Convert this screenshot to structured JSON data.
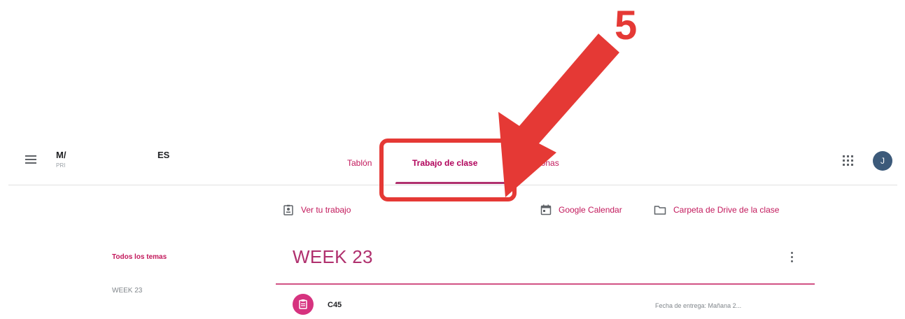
{
  "annotation": {
    "step_number": "5",
    "color": "#e53935"
  },
  "header": {
    "class_name": "M/",
    "class_name_extra": "ES",
    "class_section": "PRI",
    "avatar_initial": "J",
    "avatar_color": "#3c5a7a",
    "tabs": [
      {
        "label": "Tablón"
      },
      {
        "label": "Trabajo de clase",
        "active": true
      },
      {
        "label": "Personas"
      }
    ]
  },
  "toolbar": {
    "view_work": "Ver tu trabajo",
    "calendar": "Google Calendar",
    "drive": "Carpeta de Drive de la clase"
  },
  "topics_nav": {
    "all": "Todos los temas",
    "items": [
      "WEEK 23"
    ]
  },
  "topic": {
    "title": "WEEK 23",
    "assignments": [
      {
        "title": "C45",
        "due": "Fecha de entrega: Mañana 2..."
      }
    ]
  },
  "colors": {
    "accent": "#c2185b",
    "topic_title": "#b0306e",
    "assignment_icon": "#d6337f"
  },
  "icons": {
    "menu": "hamburger-icon",
    "apps": "apps-grid-icon",
    "view_work": "assignment-ind-icon",
    "calendar": "calendar-icon",
    "drive": "folder-icon",
    "more": "more-vert-icon",
    "assignment": "assignment-icon"
  }
}
